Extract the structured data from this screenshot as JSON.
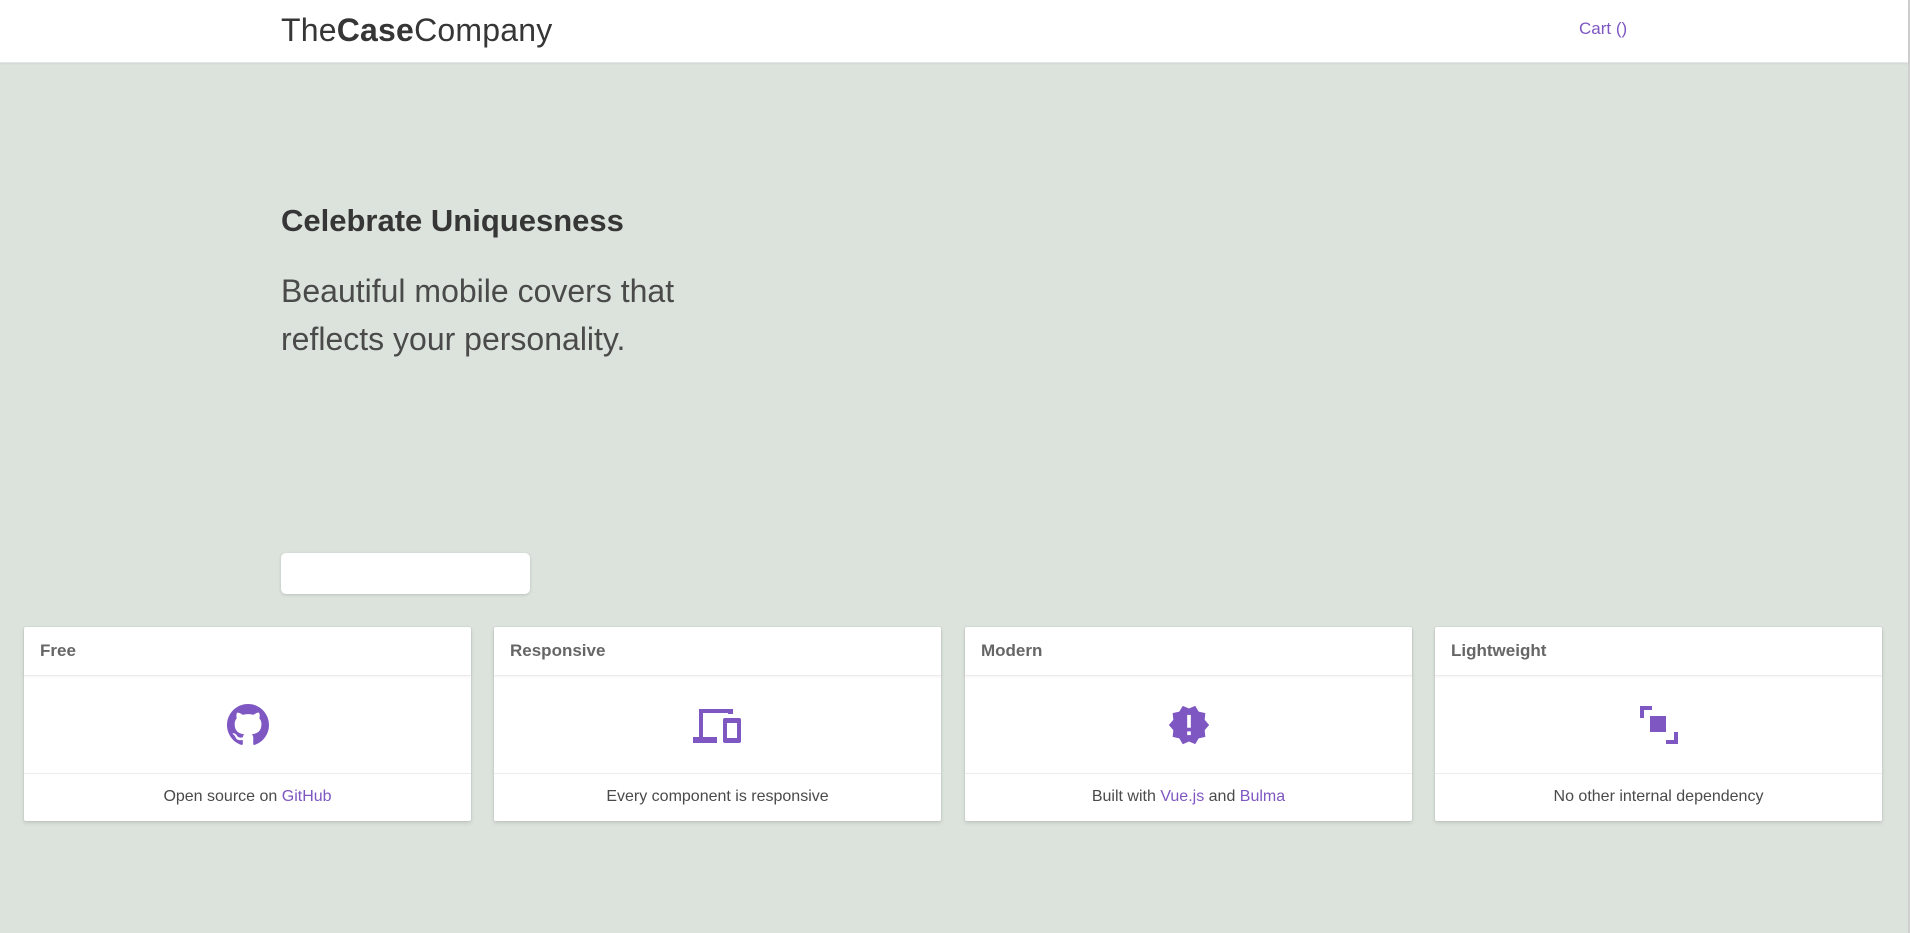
{
  "navbar": {
    "brand_part1": "The",
    "brand_part2": "Case",
    "brand_part3": "Company",
    "cart_label": "Cart ()"
  },
  "hero": {
    "title": "Celebrate Uniquesness",
    "subtitle": "Beautiful mobile covers that reflects your personality.",
    "button_label": ""
  },
  "features": [
    {
      "title": "Free",
      "icon": "github-icon",
      "text_prefix": "Open source on ",
      "link1": "GitHub"
    },
    {
      "title": "Responsive",
      "icon": "devices-icon",
      "text": "Every component is responsive"
    },
    {
      "title": "Modern",
      "icon": "new-badge-icon",
      "text_prefix": "Built with ",
      "link1": "Vue.js",
      "text_middle": " and ",
      "link2": "Bulma"
    },
    {
      "title": "Lightweight",
      "icon": "shrink-icon",
      "text": "No other internal dependency"
    }
  ],
  "colors": {
    "accent": "#7e57c2",
    "hero_bg": "#dce3dc",
    "text_dark": "#363636"
  }
}
